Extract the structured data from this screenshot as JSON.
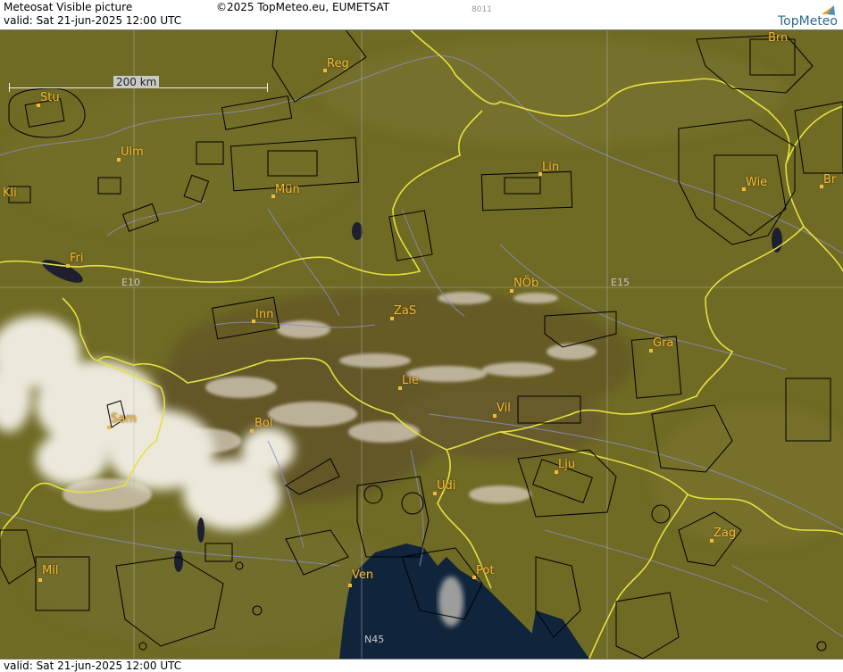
{
  "header": {
    "title": "Meteosat Visible picture",
    "valid": "valid:  Sat  21-jun-2025  12:00 UTC",
    "copyright": "©2025 TopMeteo.eu, EUMETSAT",
    "code": "8011",
    "logo": "TopMeteo"
  },
  "footer": {
    "valid": "valid:  Sat  21-jun-2025  12:00 UTC"
  },
  "scale": {
    "label": "200 km"
  },
  "colors": {
    "land": "#6f6a24",
    "sea": "#10243c",
    "border": "#e6e040",
    "river": "#8a8fc4",
    "airspace": "#000000",
    "city": "#f4b83a",
    "cloud": "#e9e6d8"
  },
  "cities": [
    {
      "id": "reg",
      "label": "Reg"
    },
    {
      "id": "brn",
      "label": "Brn"
    },
    {
      "id": "stu",
      "label": "Stu"
    },
    {
      "id": "ulm",
      "label": "Ulm"
    },
    {
      "id": "mun",
      "label": "Mün"
    },
    {
      "id": "lin",
      "label": "Lin"
    },
    {
      "id": "wie",
      "label": "Wie"
    },
    {
      "id": "bra",
      "label": "Br"
    },
    {
      "id": "kli",
      "label": "Kli"
    },
    {
      "id": "fri",
      "label": "Fri"
    },
    {
      "id": "nob",
      "label": "NÖb"
    },
    {
      "id": "inn",
      "label": "Inn"
    },
    {
      "id": "zas",
      "label": "ZaS"
    },
    {
      "id": "gra",
      "label": "Gra"
    },
    {
      "id": "lie",
      "label": "Lie"
    },
    {
      "id": "vil",
      "label": "Vil"
    },
    {
      "id": "sam",
      "label": "Sam"
    },
    {
      "id": "bol",
      "label": "Bol"
    },
    {
      "id": "lju",
      "label": "Lju"
    },
    {
      "id": "udi",
      "label": "Udi"
    },
    {
      "id": "zag",
      "label": "Zag"
    },
    {
      "id": "mil",
      "label": "Mil"
    },
    {
      "id": "ven",
      "label": "Ven"
    },
    {
      "id": "pot",
      "label": "Pot"
    }
  ],
  "grid_labels": [
    {
      "id": "e10",
      "label": "E10"
    },
    {
      "id": "e15",
      "label": "E15"
    },
    {
      "id": "n45",
      "label": "N45"
    }
  ]
}
